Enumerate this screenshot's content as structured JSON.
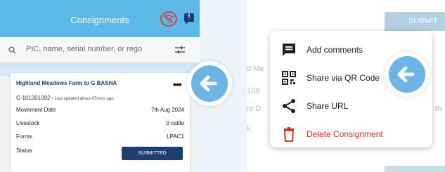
{
  "left_screen": {
    "title": "Consignments",
    "search_placeholder": "PIC, name, serial number, or rego",
    "card": {
      "title": "Highland Meadows Farm to G BASHA",
      "more_icon": "•••",
      "serial": "C-101301092",
      "last_updated": "• Last updated about 47mins ago",
      "rows": [
        {
          "label": "Movement Date",
          "value": "7th Aug 2024"
        },
        {
          "label": "Livestock",
          "value": "0 cattle"
        },
        {
          "label": "Forms",
          "value": "LPAC1"
        },
        {
          "label": "Status",
          "value": ""
        }
      ],
      "status_button": "SUBMITTED"
    },
    "message_icon_text": "!"
  },
  "right_screen": {
    "submit_partial": "SUBMIT",
    "bg_text_1": "d Me",
    "bg_text_2": "108",
    "bg_text_3": "nt D",
    "bg_text_4": "k",
    "bg_text_5": "th",
    "menu_items": [
      {
        "label": "Add comments",
        "icon": "comment-icon"
      },
      {
        "label": "Share via QR Code",
        "icon": "qr-code-icon"
      },
      {
        "label": "Share URL",
        "icon": "share-icon"
      },
      {
        "label": "Delete Consignment",
        "icon": "trash-icon"
      }
    ]
  },
  "colors": {
    "header_blue": "#5cb8e8",
    "navy": "#1b3f73",
    "arrow_blue": "#6ab5e6",
    "delete_red": "#d63a2e"
  }
}
